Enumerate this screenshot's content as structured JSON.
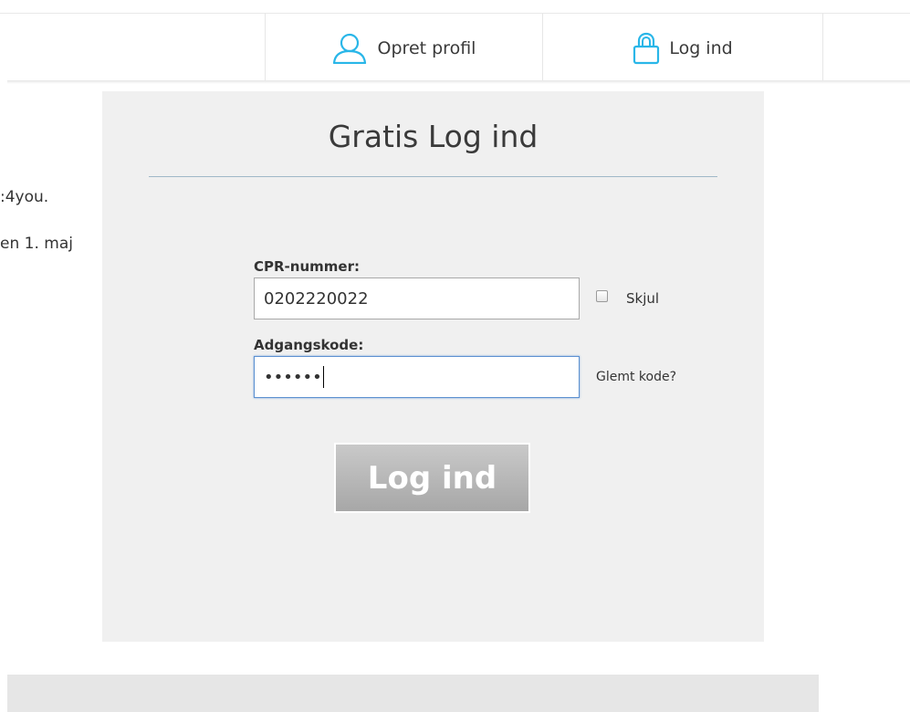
{
  "header": {
    "nav": {
      "signup_label": "Opret profil",
      "login_label": "Log ind"
    },
    "icons": {
      "signup": "user-icon",
      "login": "padlock-icon"
    },
    "accent_color": "#29b6e8"
  },
  "background": {
    "line1": ":4you.",
    "line2": "en 1. maj"
  },
  "login_modal": {
    "title": "Gratis Log ind",
    "cpr": {
      "label": "CPR-nummer:",
      "value": "0202220022"
    },
    "hide_checkbox": {
      "label": "Skjul",
      "checked": false
    },
    "password": {
      "label": "Adgangskode:",
      "masked_value": "••••••"
    },
    "forgot_link": "Glemt kode?",
    "submit_label": "Log ind"
  }
}
